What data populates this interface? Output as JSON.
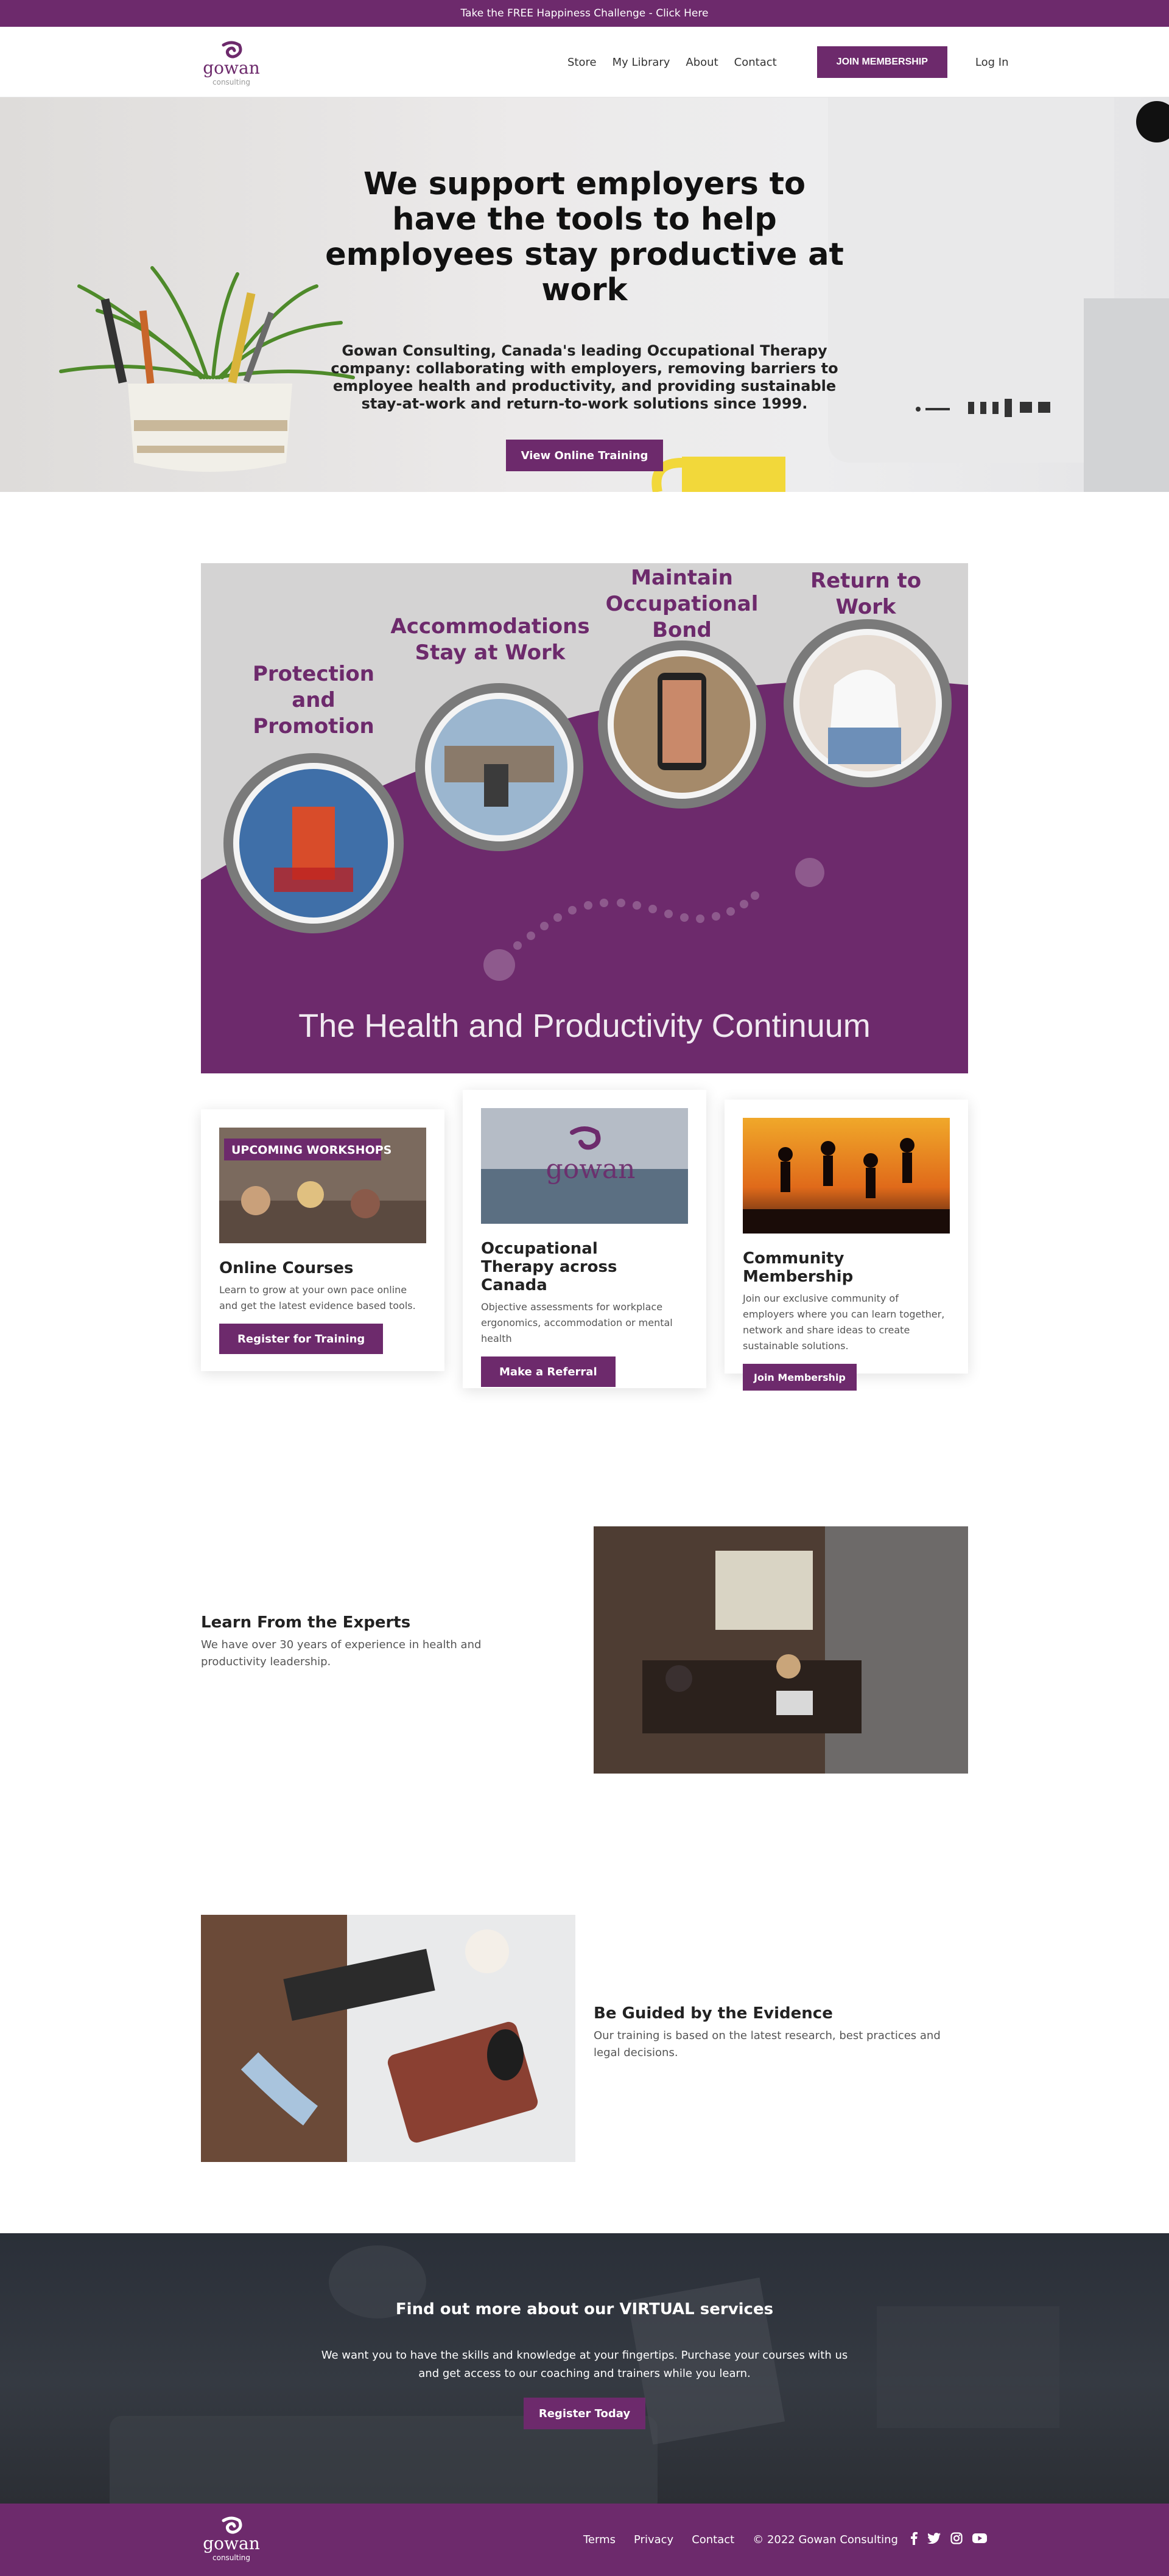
{
  "announcement": "Take the FREE Happiness Challenge - Click Here",
  "brand": {
    "name": "gowan",
    "tagline": "consulting",
    "accent": "#6d2a6c"
  },
  "nav": {
    "items": [
      "Store",
      "My Library",
      "About",
      "Contact"
    ],
    "join_label": "JOIN MEMBERSHIP",
    "login_label": "Log In"
  },
  "hero": {
    "title": "We support employers to have the tools to help employees stay productive at work",
    "subtitle": "Gowan Consulting, Canada's leading Occupational Therapy company: collaborating with employers, removing barriers to employee health and productivity, and providing sustainable stay-at-work and return-to-work solutions since 1999.",
    "button": "View Online Training"
  },
  "continuum": {
    "stages": [
      {
        "label": "Protection and Promotion",
        "lines": [
          "Protection",
          "and",
          "Promotion"
        ]
      },
      {
        "label": "Accommodations Stay at Work",
        "lines": [
          "Accommodations",
          "Stay at Work"
        ]
      },
      {
        "label": "Maintain Occupational Bond",
        "lines": [
          "Maintain",
          "Occupational",
          "Bond"
        ]
      },
      {
        "label": "Return to Work",
        "lines": [
          "Return to",
          "Work"
        ]
      }
    ],
    "caption": "The Health and Productivity Continuum"
  },
  "cards": [
    {
      "badge": "UPCOMING WORKSHOPS",
      "title": "Online Courses",
      "body": "Learn to grow at your own pace online and get the latest evidence based tools.",
      "button": "Register for Training"
    },
    {
      "title_lines": [
        "Occupational",
        "Therapy across Canada"
      ],
      "body": "Objective assessments for workplace ergonomics, accommodation or mental health",
      "button": "Make a Referral"
    },
    {
      "title": "Community Membership",
      "body": "Join our exclusive community of employers where you can learn together, network and share ideas to create sustainable solutions.",
      "button": "Join Membership"
    }
  ],
  "features": [
    {
      "title": "Learn From the Experts",
      "body": "We have over 30 years of experience in health and productivity leadership."
    },
    {
      "title": "Be Guided by the Evidence",
      "body": "Our training is based on the latest research, best practices and legal decisions."
    }
  ],
  "cta": {
    "title": "Find out more about our VIRTUAL services",
    "body": "We want you to have the skills and knowledge at your fingertips.  Purchase your courses with us and get access to our coaching and trainers while you learn.",
    "button": "Register Today"
  },
  "footer": {
    "links": [
      "Terms",
      "Privacy",
      "Contact"
    ],
    "copyright": "© 2022 Gowan Consulting",
    "social": [
      "facebook-icon",
      "twitter-icon",
      "instagram-icon",
      "youtube-icon"
    ]
  }
}
